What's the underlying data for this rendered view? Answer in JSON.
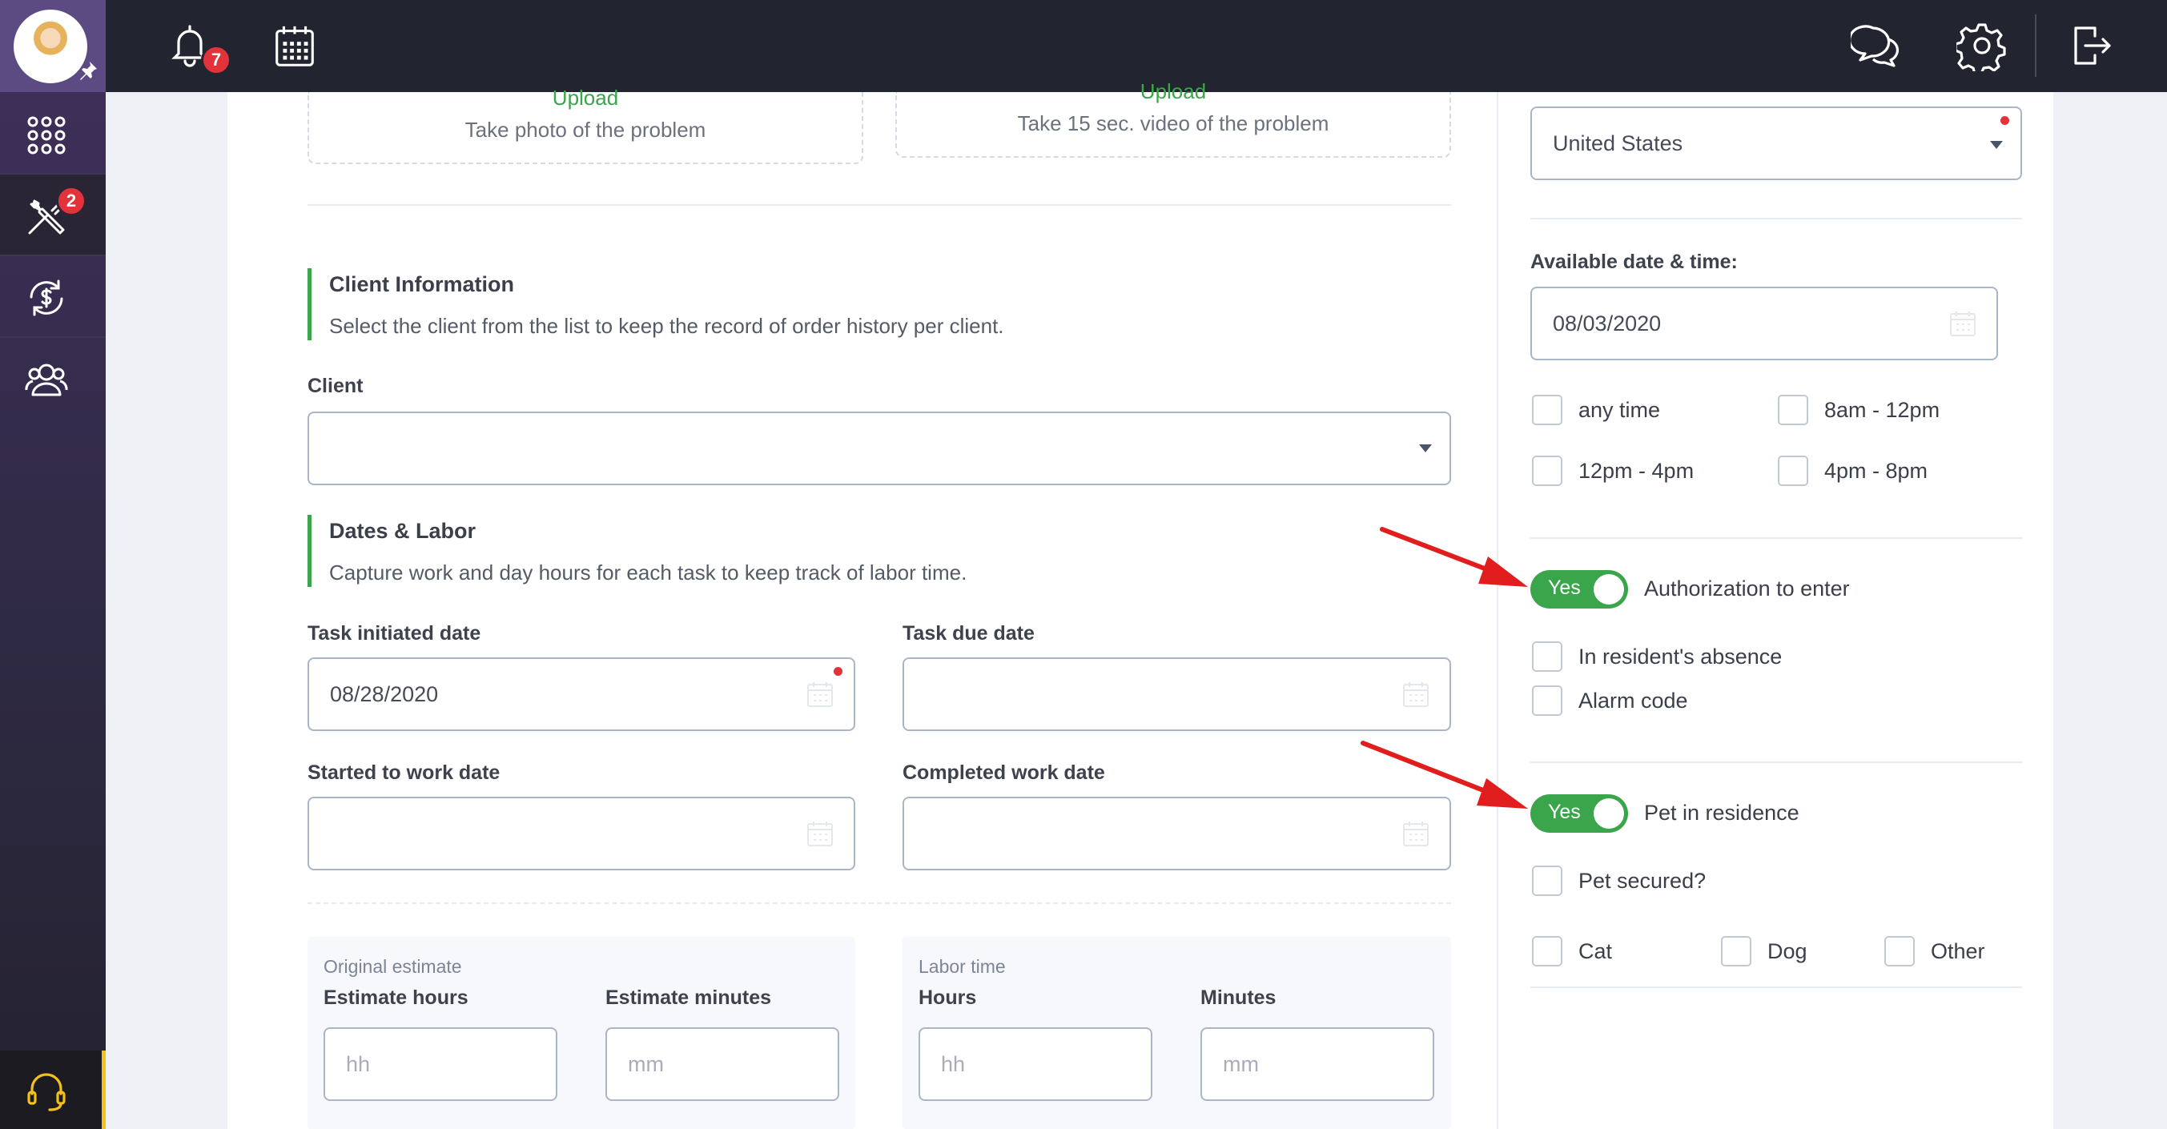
{
  "topbar": {
    "notifications_count": "7"
  },
  "sidebar": {
    "tools_badge": "2"
  },
  "upload": {
    "photo": {
      "label": "Upload",
      "description": "Take photo of the problem"
    },
    "video": {
      "label": "Upload",
      "description": "Take 15 sec. video of the problem"
    }
  },
  "client_info": {
    "title": "Client Information",
    "description": "Select the client from the list to keep the record of order history per client.",
    "client_label": "Client",
    "client_value": ""
  },
  "dates_labor": {
    "title": "Dates & Labor",
    "description": "Capture work and day hours for each task to keep track of labor time.",
    "task_initiated_label": "Task initiated date",
    "task_initiated_value": "08/28/2020",
    "task_due_label": "Task due date",
    "task_due_value": "",
    "started_label": "Started to work date",
    "started_value": "",
    "completed_label": "Completed work date",
    "completed_value": ""
  },
  "estimate": {
    "group_label": "Original estimate",
    "hours_label": "Estimate hours",
    "hours_placeholder": "hh",
    "minutes_label": "Estimate minutes",
    "minutes_placeholder": "mm"
  },
  "labor_time": {
    "group_label": "Labor time",
    "hours_label": "Hours",
    "hours_placeholder": "hh",
    "minutes_label": "Minutes",
    "minutes_placeholder": "mm"
  },
  "right": {
    "country_value": "United States",
    "available_label": "Available date & time:",
    "available_date": "08/03/2020",
    "time_slots": [
      "any time",
      "8am - 12pm",
      "12pm - 4pm",
      "4pm - 8pm"
    ],
    "authorization": {
      "toggle_text": "Yes",
      "label": "Authorization to enter",
      "options": [
        "In resident's absence",
        "Alarm code"
      ]
    },
    "pet": {
      "toggle_text": "Yes",
      "label": "Pet in residence",
      "secured_label": "Pet secured?",
      "types": [
        "Cat",
        "Dog",
        "Other"
      ]
    }
  },
  "colors": {
    "accent_green": "#3aa54a",
    "topbar_bg": "#22252f",
    "badge_red": "#e2333b",
    "annotation_arrow": "#e21d1d"
  }
}
